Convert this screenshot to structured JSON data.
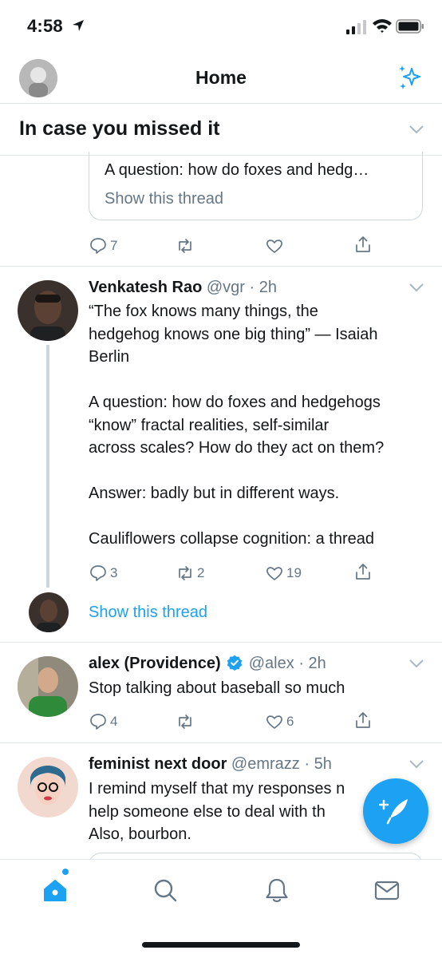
{
  "status": {
    "time": "4:58"
  },
  "header": {
    "title": "Home"
  },
  "icymi": {
    "title": "In case you missed it"
  },
  "quoted": {
    "text": "A question: how do foxes and hedg…",
    "link": "Show this thread",
    "replies": "7"
  },
  "tweets": [
    {
      "name": "Venkatesh Rao",
      "handle": "@vgr",
      "time": "· 2h",
      "lines": [
        "“The fox knows many things, the",
        "hedgehog knows one big thing” — Isaiah",
        "Berlin",
        "",
        "A question: how do foxes and hedgehogs",
        "“know” fractal realities, self-similar",
        "across scales? How do they act on them?",
        "",
        "Answer: badly but in different ways.",
        "",
        "Cauliflowers collapse cognition: a thread"
      ],
      "replies": "3",
      "retweets": "2",
      "likes": "19",
      "show_thread": "Show this thread"
    },
    {
      "name": "alex (Providence)",
      "handle": "@alex",
      "time": "· 2h",
      "text": "Stop talking about baseball so much",
      "replies": "4",
      "likes": "6"
    },
    {
      "name": "feminist next door",
      "handle": "@emrazz",
      "time": "· 5h",
      "lines": [
        "I remind myself that my responses n",
        "help someone else to deal with th",
        "Also, bourbon."
      ]
    }
  ],
  "colors": {
    "accent": "#1da1f2",
    "muted": "#657786",
    "text": "#14171a",
    "border": "#e1e8ed"
  },
  "icons": [
    "location-arrow-icon",
    "signal-icon",
    "wifi-icon",
    "battery-icon",
    "sparkle-icon",
    "chevron-down-icon",
    "reply-icon",
    "retweet-icon",
    "like-icon",
    "share-icon",
    "compose-icon",
    "home-icon",
    "search-icon",
    "bell-icon",
    "mail-icon"
  ]
}
